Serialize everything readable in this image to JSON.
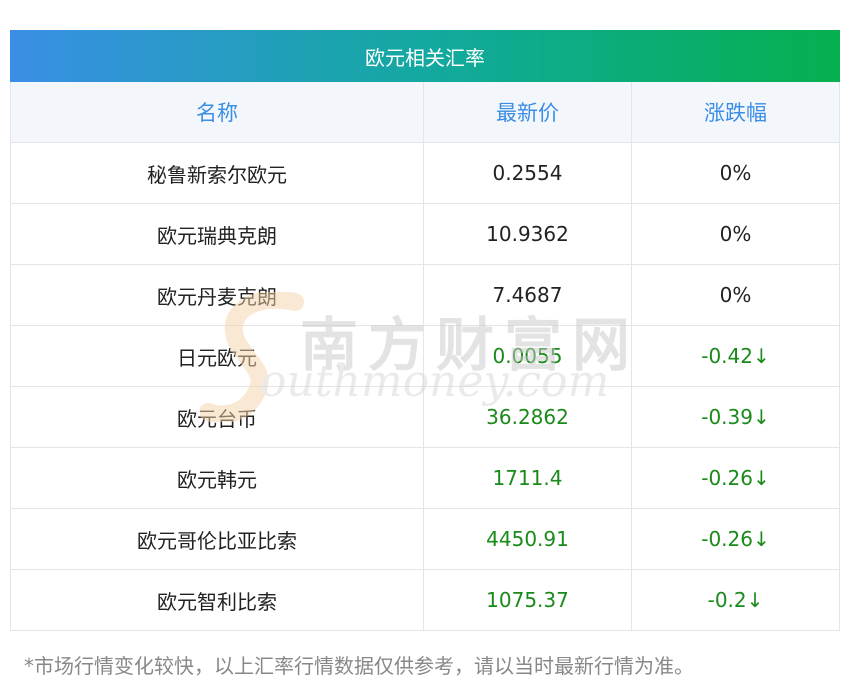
{
  "table": {
    "title": "欧元相关汇率",
    "columns": [
      "名称",
      "最新价",
      "涨跌幅"
    ],
    "rows": [
      {
        "name": "秘鲁新索尔欧元",
        "price": "0.2554",
        "change": "0%",
        "trend": "flat"
      },
      {
        "name": "欧元瑞典克朗",
        "price": "10.9362",
        "change": "0%",
        "trend": "flat"
      },
      {
        "name": "欧元丹麦克朗",
        "price": "7.4687",
        "change": "0%",
        "trend": "flat"
      },
      {
        "name": "日元欧元",
        "price": "0.0055",
        "change": "-0.42↓",
        "trend": "down"
      },
      {
        "name": "欧元台币",
        "price": "36.2862",
        "change": "-0.39↓",
        "trend": "down"
      },
      {
        "name": "欧元韩元",
        "price": "1711.4",
        "change": "-0.26↓",
        "trend": "down"
      },
      {
        "name": "欧元哥伦比亚比索",
        "price": "4450.91",
        "change": "-0.26↓",
        "trend": "down"
      },
      {
        "name": "欧元智利比索",
        "price": "1075.37",
        "change": "-0.2↓",
        "trend": "down"
      }
    ]
  },
  "footnote": "*市场行情变化较快，以上汇率行情数据仅供参考，请以当时最新行情为准。",
  "watermark": {
    "cn": "南方财富网",
    "en": "outhmoney.com"
  },
  "colors": {
    "header_gradient_start": "#3a8ee6",
    "header_gradient_end": "#05b04e",
    "column_head_text": "#3a8ee6",
    "down": "#1a8a1a",
    "watermark_s": "#f5d3a8"
  }
}
